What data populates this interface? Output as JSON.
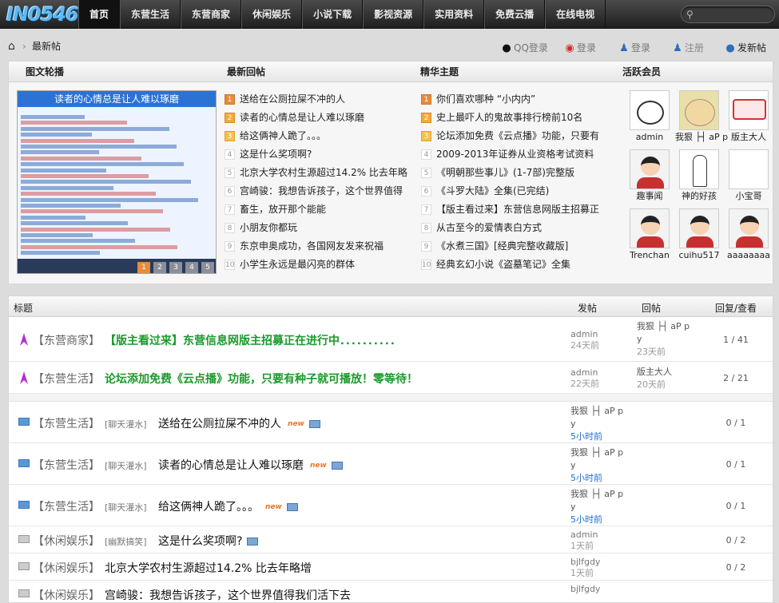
{
  "site": {
    "logo_text": "IN0546"
  },
  "nav": {
    "items": [
      "首页",
      "东营生活",
      "东营商家",
      "休闲娱乐",
      "小说下载",
      "影视资源",
      "实用资料",
      "免费云播",
      "在线电视"
    ],
    "active": "首页",
    "search_placeholder": ""
  },
  "breadcrumb": {
    "current": "最新帖"
  },
  "user_links": {
    "qq_login": "QQ登录",
    "weibo_login": "登录",
    "login": "登录",
    "register": "注册",
    "post": "发新帖"
  },
  "panel": {
    "titles": {
      "slides": "图文轮播",
      "latest": "最新回帖",
      "featured": "精华主题",
      "members": "活跃会员"
    },
    "slide": {
      "caption": "读者的心情总是让人难以琢磨",
      "pages": [
        "1",
        "2",
        "3",
        "4",
        "5"
      ],
      "active_page": "1"
    },
    "latest": [
      {
        "n": "1",
        "t": "送给在公厕拉屎不冲的人"
      },
      {
        "n": "2",
        "t": "读者的心情总是让人难以琢磨"
      },
      {
        "n": "3",
        "t": "给这俩神人跪了。。。"
      },
      {
        "n": "4",
        "t": "这是什么奖项啊?"
      },
      {
        "n": "5",
        "t": "北京大学农村生源超过14.2% 比去年略"
      },
      {
        "n": "6",
        "t": "宫崎骏：我想告诉孩子，这个世界值得"
      },
      {
        "n": "7",
        "t": "畜生，放开那个能能"
      },
      {
        "n": "8",
        "t": "小朋友你都玩"
      },
      {
        "n": "9",
        "t": "东京申奥成功，各国网友发来祝福"
      },
      {
        "n": "10",
        "t": "小学生永远是最闪亮的群体"
      }
    ],
    "featured": [
      {
        "n": "1",
        "t": "你们喜欢哪种 “小内内”"
      },
      {
        "n": "2",
        "t": "史上最吓人的鬼故事排行榜前10名"
      },
      {
        "n": "3",
        "t": "论坛添加免费《云点播》功能，只要有"
      },
      {
        "n": "4",
        "t": "2009-2013年证券从业资格考试资料"
      },
      {
        "n": "5",
        "t": "《明朝那些事儿》(1-7部)完整版"
      },
      {
        "n": "6",
        "t": "《斗罗大陆》全集(已完结)"
      },
      {
        "n": "7",
        "t": "【版主看过来】东营信息网版主招募正"
      },
      {
        "n": "8",
        "t": "从古至今的爱情表白方式"
      },
      {
        "n": "9",
        "t": "《水煮三国》[经典完整收藏版]"
      },
      {
        "n": "10",
        "t": "经典玄幻小说《盗墓笔记》全集"
      }
    ],
    "members": [
      {
        "name": "admin",
        "avatar": "cat-avatar"
      },
      {
        "name": "我狠 ├┤ aΡ p",
        "avatar": "cartoon-avatar"
      },
      {
        "name": "版主大人",
        "avatar": "a-gou-avatar"
      },
      {
        "name": "趣事闻",
        "avatar": "default-avatar"
      },
      {
        "name": "神的好孩",
        "avatar": "sketch-avatar"
      },
      {
        "name": "小宝哥",
        "avatar": "blank-avatar"
      },
      {
        "name": "Trenchan",
        "avatar": "default-avatar"
      },
      {
        "name": "cuihu517",
        "avatar": "default-avatar"
      },
      {
        "name": "aaaaaaaa",
        "avatar": "default-avatar"
      }
    ]
  },
  "threads": {
    "headers": {
      "title": "标题",
      "author": "发帖",
      "last": "回帖",
      "stats": "回复/查看"
    },
    "rows": [
      {
        "type": "sticky",
        "forum": "【东营商家】",
        "category": "",
        "title": "【版主看过来】东营信息网版主招募正在进行中．．．．．．．．．．",
        "author": "admin",
        "author_date": "24天前",
        "last": "我狠 ├┤ aΡ p",
        "last_line2": "y",
        "last_date": "23天前",
        "stats": "1 / 41"
      },
      {
        "type": "sticky",
        "forum": "【东营生活】",
        "category": "",
        "title": "论坛添加免费《云点播》功能，只要有种子就可播放！零等待！",
        "author": "admin",
        "author_date": "22天前",
        "last": "版主大人",
        "last_line2": "",
        "last_date": "20天前",
        "stats": "2 / 21"
      },
      {
        "type": "normal",
        "forum": "【东营生活】",
        "category": "[聊天灌水]",
        "title": "送给在公厕拉屎不冲的人",
        "badge": "new",
        "author": "我狠 ├┤ aΡ p",
        "author_date": "y",
        "author_date2": "5小时前",
        "stats": "0 / 1"
      },
      {
        "type": "normal",
        "forum": "【东营生活】",
        "category": "[聊天灌水]",
        "title": "读者的心情总是让人难以琢磨",
        "badge": "new",
        "author": "我狠 ├┤ aΡ p",
        "author_date": "y",
        "author_date2": "5小时前",
        "stats": "0 / 1"
      },
      {
        "type": "normal",
        "forum": "【东营生活】",
        "category": "[聊天灌水]",
        "title": "给这俩神人跪了。。。",
        "badge": "new",
        "author": "我狠 ├┤ aΡ p",
        "author_date": "y",
        "author_date2": "5小时前",
        "stats": "0 / 1"
      },
      {
        "type": "old",
        "forum": "【休闲娱乐】",
        "category": "[幽默搞笑]",
        "title": "这是什么奖项啊?",
        "badge": "",
        "author": "admin",
        "author_date": "1天前",
        "stats": "0 / 2"
      },
      {
        "type": "old",
        "forum": "【休闲娱乐】",
        "category": "",
        "title": "北京大学农村生源超过14.2% 比去年略增",
        "badge": "",
        "author": "bjlfgdy",
        "author_date": "1天前",
        "stats": "0 / 2"
      },
      {
        "type": "old",
        "forum": "【休闲娱乐】",
        "category": "",
        "title": "宫崎骏：我想告诉孩子，这个世界值得我们活下去",
        "badge": "",
        "author": "bjlfgdy",
        "author_date": "",
        "stats": ""
      }
    ]
  },
  "colors": {
    "accent": "#1e6fd0",
    "sticky_title": "#1a9a2a",
    "nav_bg": "#2e2e2e",
    "badge": "#e88b3b"
  }
}
